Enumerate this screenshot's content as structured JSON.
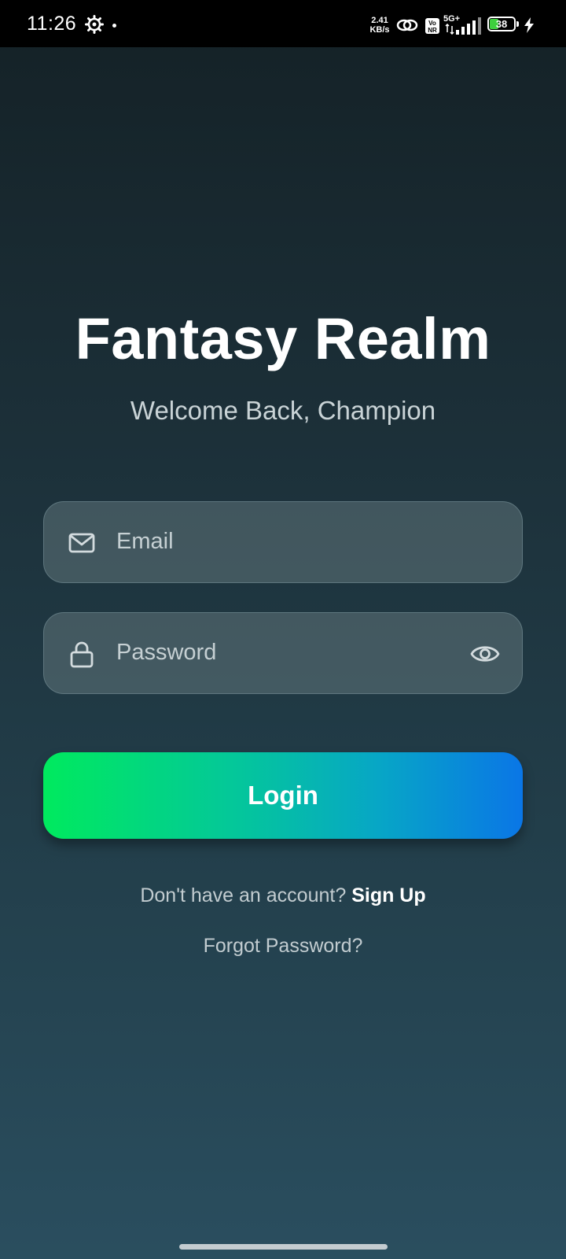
{
  "status_bar": {
    "time": "11:26",
    "net_speed_value": "2.41",
    "net_speed_unit": "KB/s",
    "network": "5G+",
    "volte": "Vo NR",
    "battery_level": "38",
    "battery_fill": 0.38,
    "battery_color": "#3ecf3e"
  },
  "app": {
    "title": "Fantasy Realm",
    "subtitle": "Welcome Back, Champion"
  },
  "form": {
    "email_placeholder": "Email",
    "password_placeholder": "Password",
    "login_label": "Login",
    "no_account_text": "Don't have an account?",
    "signup_label": "Sign Up",
    "forgot_label": "Forgot Password?"
  },
  "colors": {
    "gradient_start": "#00ea5e",
    "gradient_end": "#0a76e6",
    "background_top": "#142126",
    "background_bottom": "#2a4e5f"
  },
  "icons": {
    "email": "mail-icon",
    "password": "lock-icon",
    "visibility": "eye-icon"
  }
}
